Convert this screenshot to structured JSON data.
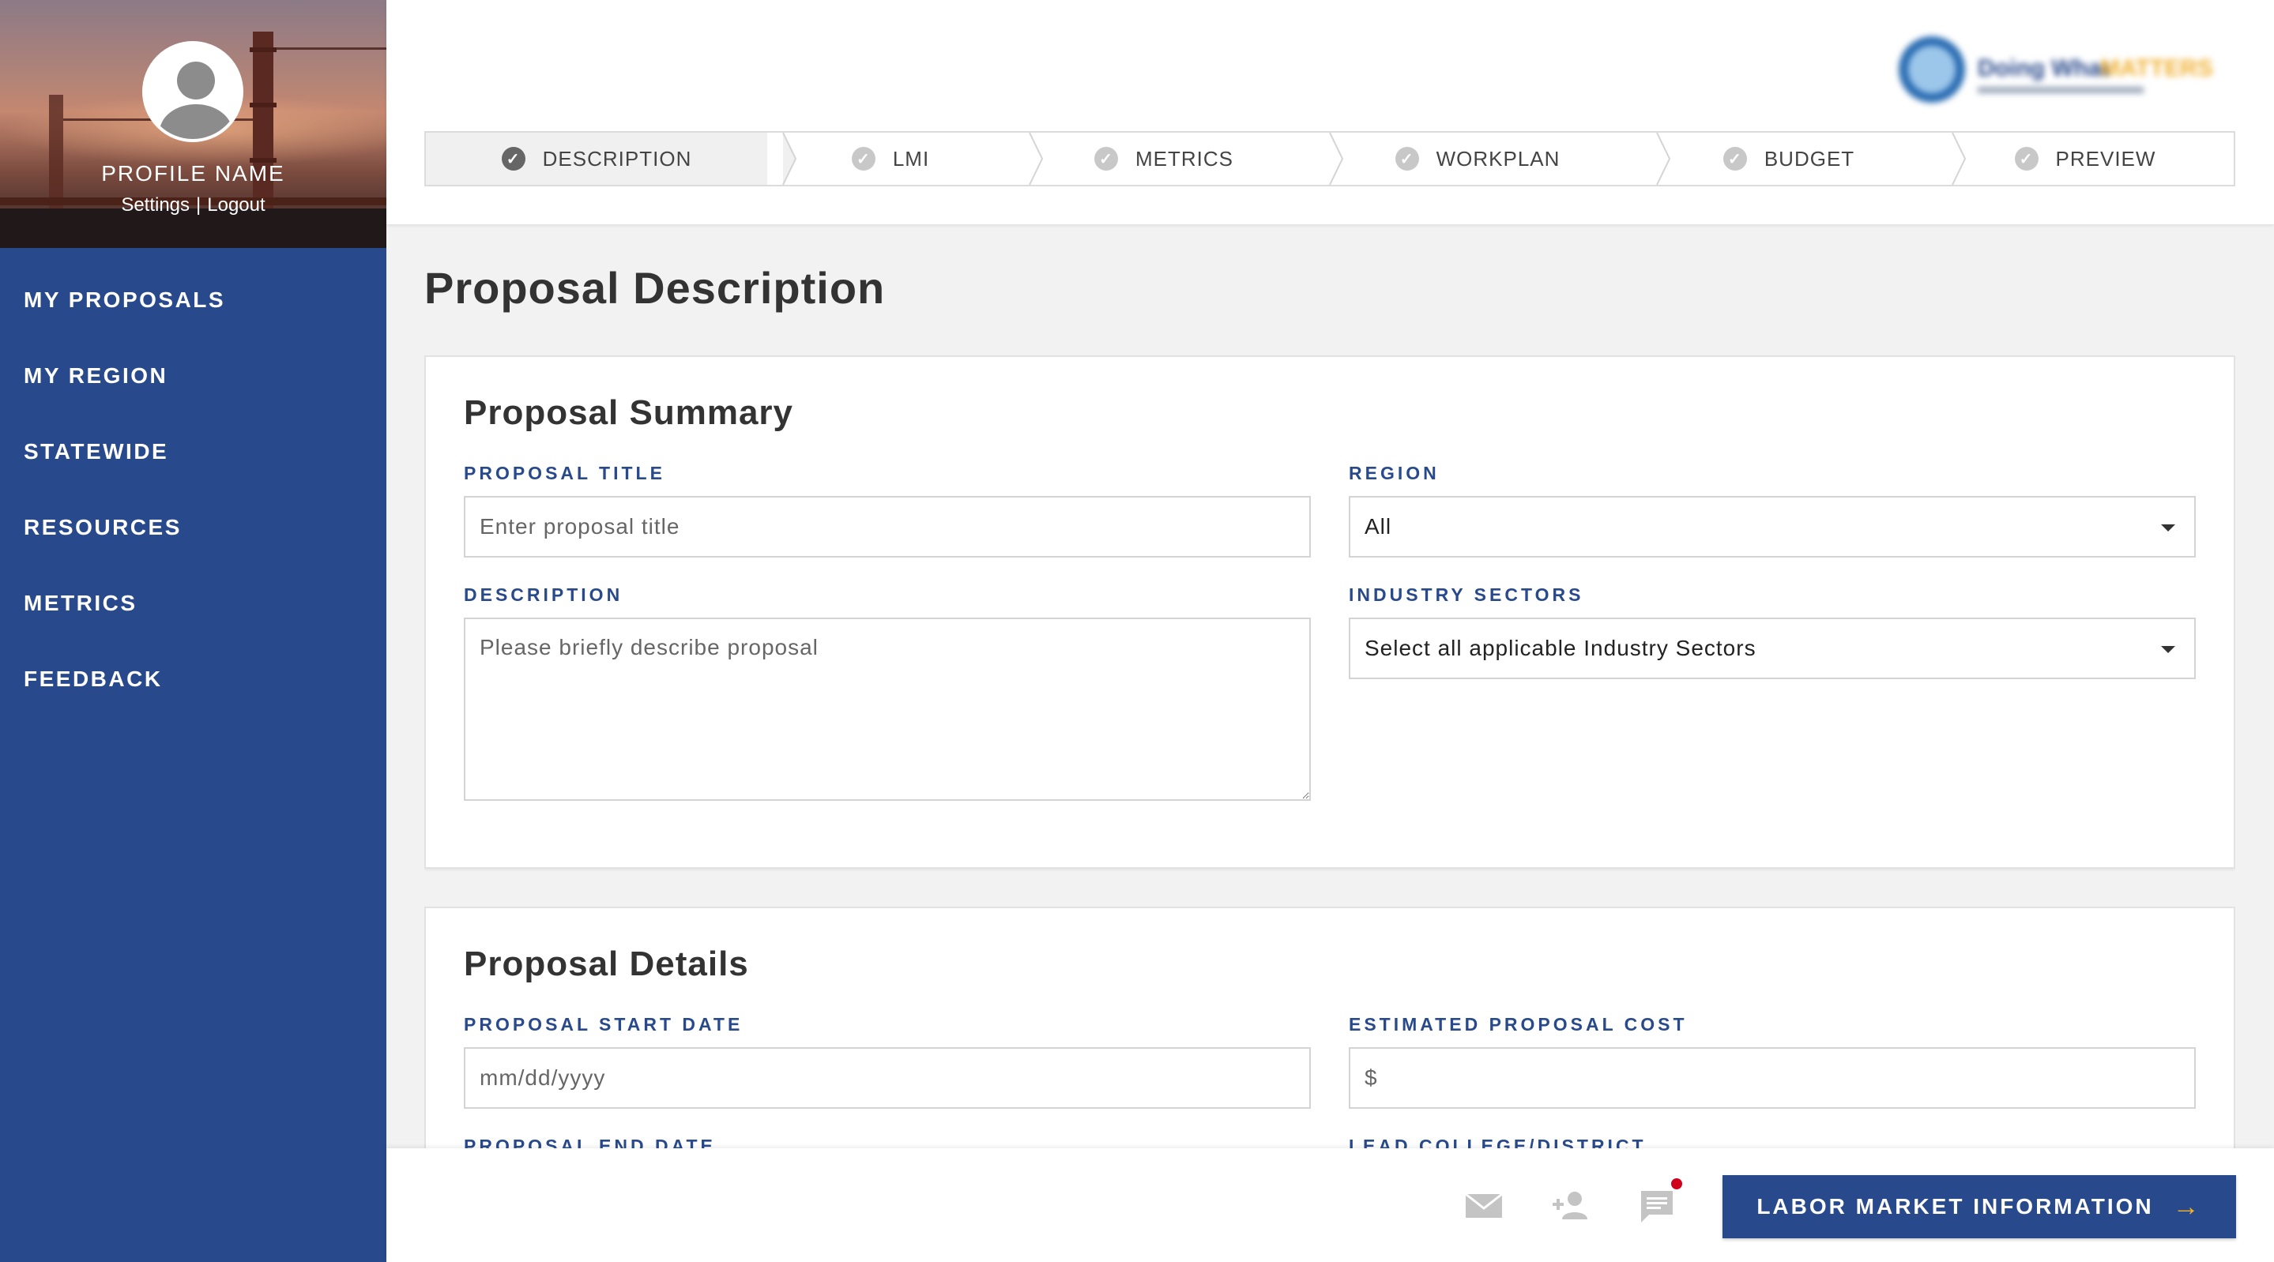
{
  "profile": {
    "name": "PROFILE NAME",
    "settings": "Settings",
    "separator": "|",
    "logout": "Logout"
  },
  "nav": {
    "items": [
      {
        "label": "MY PROPOSALS"
      },
      {
        "label": "MY REGION"
      },
      {
        "label": "STATEWIDE"
      },
      {
        "label": "RESOURCES"
      },
      {
        "label": "METRICS"
      },
      {
        "label": "FEEDBACK"
      }
    ]
  },
  "logo": {
    "alt": "Doing What MATTERS",
    "word1": "Doing What",
    "word2": "MATTERS"
  },
  "steps": [
    {
      "label": "DESCRIPTION",
      "active": true
    },
    {
      "label": "LMI"
    },
    {
      "label": "METRICS"
    },
    {
      "label": "WORKPLAN"
    },
    {
      "label": "BUDGET"
    },
    {
      "label": "PREVIEW"
    }
  ],
  "page": {
    "title": "Proposal Description"
  },
  "summary": {
    "title": "Proposal Summary",
    "proposal_title": {
      "label": "PROPOSAL TITLE",
      "placeholder": "Enter proposal title"
    },
    "region": {
      "label": "REGION",
      "value": "All"
    },
    "description": {
      "label": "DESCRIPTION",
      "placeholder": "Please briefly describe proposal"
    },
    "industry": {
      "label": "INDUSTRY SECTORS",
      "value": "Select all applicable Industry Sectors"
    }
  },
  "details": {
    "title": "Proposal Details",
    "start_date": {
      "label": "PROPOSAL START DATE",
      "placeholder": "mm/dd/yyyy"
    },
    "cost": {
      "label": "ESTIMATED PROPOSAL COST",
      "placeholder": "$"
    },
    "end_date": {
      "label": "PROPOSAL END DATE"
    },
    "lead": {
      "label": "LEAD COLLEGE/DISTRICT"
    }
  },
  "footer": {
    "icons": [
      "mail-icon",
      "add-person-icon",
      "chat-icon"
    ],
    "next_button": "LABOR MARKET INFORMATION",
    "next_arrow": "→",
    "colors": {
      "primary": "#284a8c",
      "accent": "#f5b325",
      "notification": "#d0021b"
    }
  }
}
